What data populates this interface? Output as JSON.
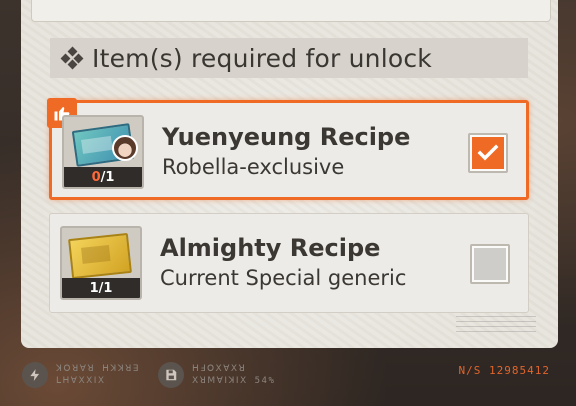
{
  "section": {
    "title": "Item(s) required for unlock"
  },
  "items": [
    {
      "name": "Yuenyeung Recipe",
      "description": "Robella-exclusive",
      "count_have": "0",
      "count_sep_total": "/1",
      "checked": true,
      "recommended_badge": "thumbs-up-icon"
    },
    {
      "name": "Almighty Recipe",
      "description": "Current Special generic",
      "count_have": "1",
      "count_sep_total": "/1",
      "checked": false
    }
  ],
  "footer": {
    "left_glyphs_line1": "ꓘꓳꓤꓯꓤ ꓧꓘꓘꓤꓱ",
    "left_glyphs_line2": "ꓡꓧꓯꓫꓫꓲꓫ",
    "right_glyphs_line1": "ꓧꓞꓳꓫꓯꓫꓤ",
    "right_glyphs_line2": "ꓫꓤꓟꓯꓲꓘꓲꓫ 54%",
    "serial": "N/S 12985412"
  },
  "colors": {
    "accent": "#ee6a25",
    "panel": "#e7e4dd",
    "text": "#3b3733"
  }
}
